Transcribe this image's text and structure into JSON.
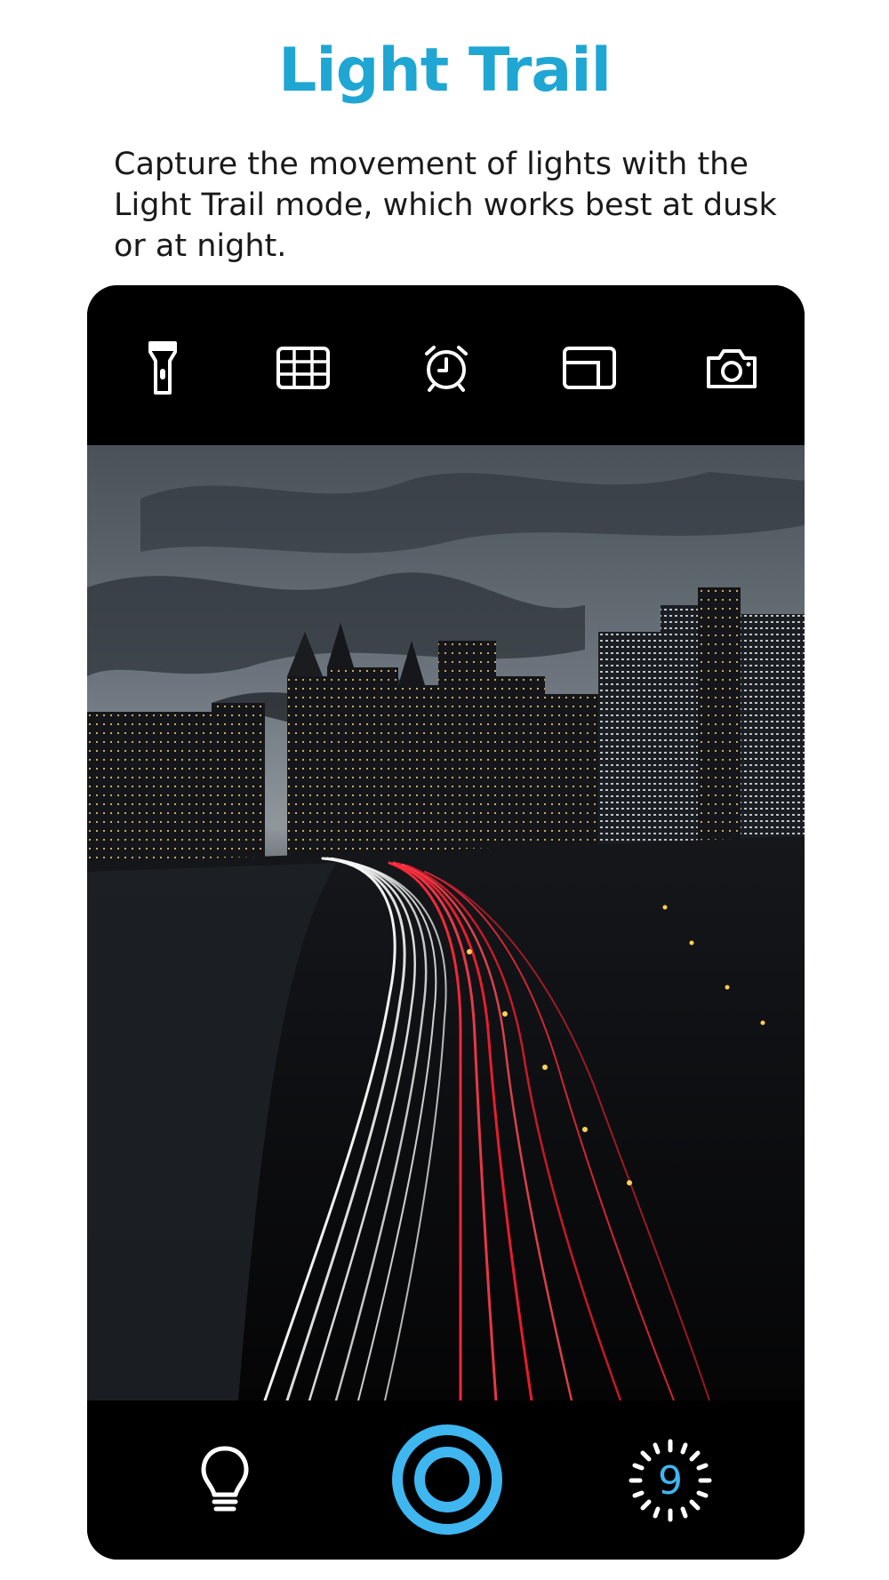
{
  "header": {
    "title": "Light Trail",
    "description": "Capture the movement of lights with the Light Trail mode, which works best at dusk or at night."
  },
  "top_toolbar": {
    "items": [
      {
        "icon": "flashlight-icon"
      },
      {
        "icon": "grid-icon"
      },
      {
        "icon": "timer-icon"
      },
      {
        "icon": "aspect-ratio-icon"
      },
      {
        "icon": "switch-camera-icon"
      }
    ]
  },
  "viewfinder": {
    "scene": "night city skyline with light trails on highway"
  },
  "bottom_toolbar": {
    "left_icon": "lightbulb-icon",
    "shutter_icon": "shutter-button",
    "right_icon": "brightness-icon",
    "brightness_value": "9"
  },
  "colors": {
    "accent": "#1fa6d3",
    "shutter": "#3fb6f0",
    "toolbar_bg": "#000000",
    "icon": "#ffffff"
  }
}
